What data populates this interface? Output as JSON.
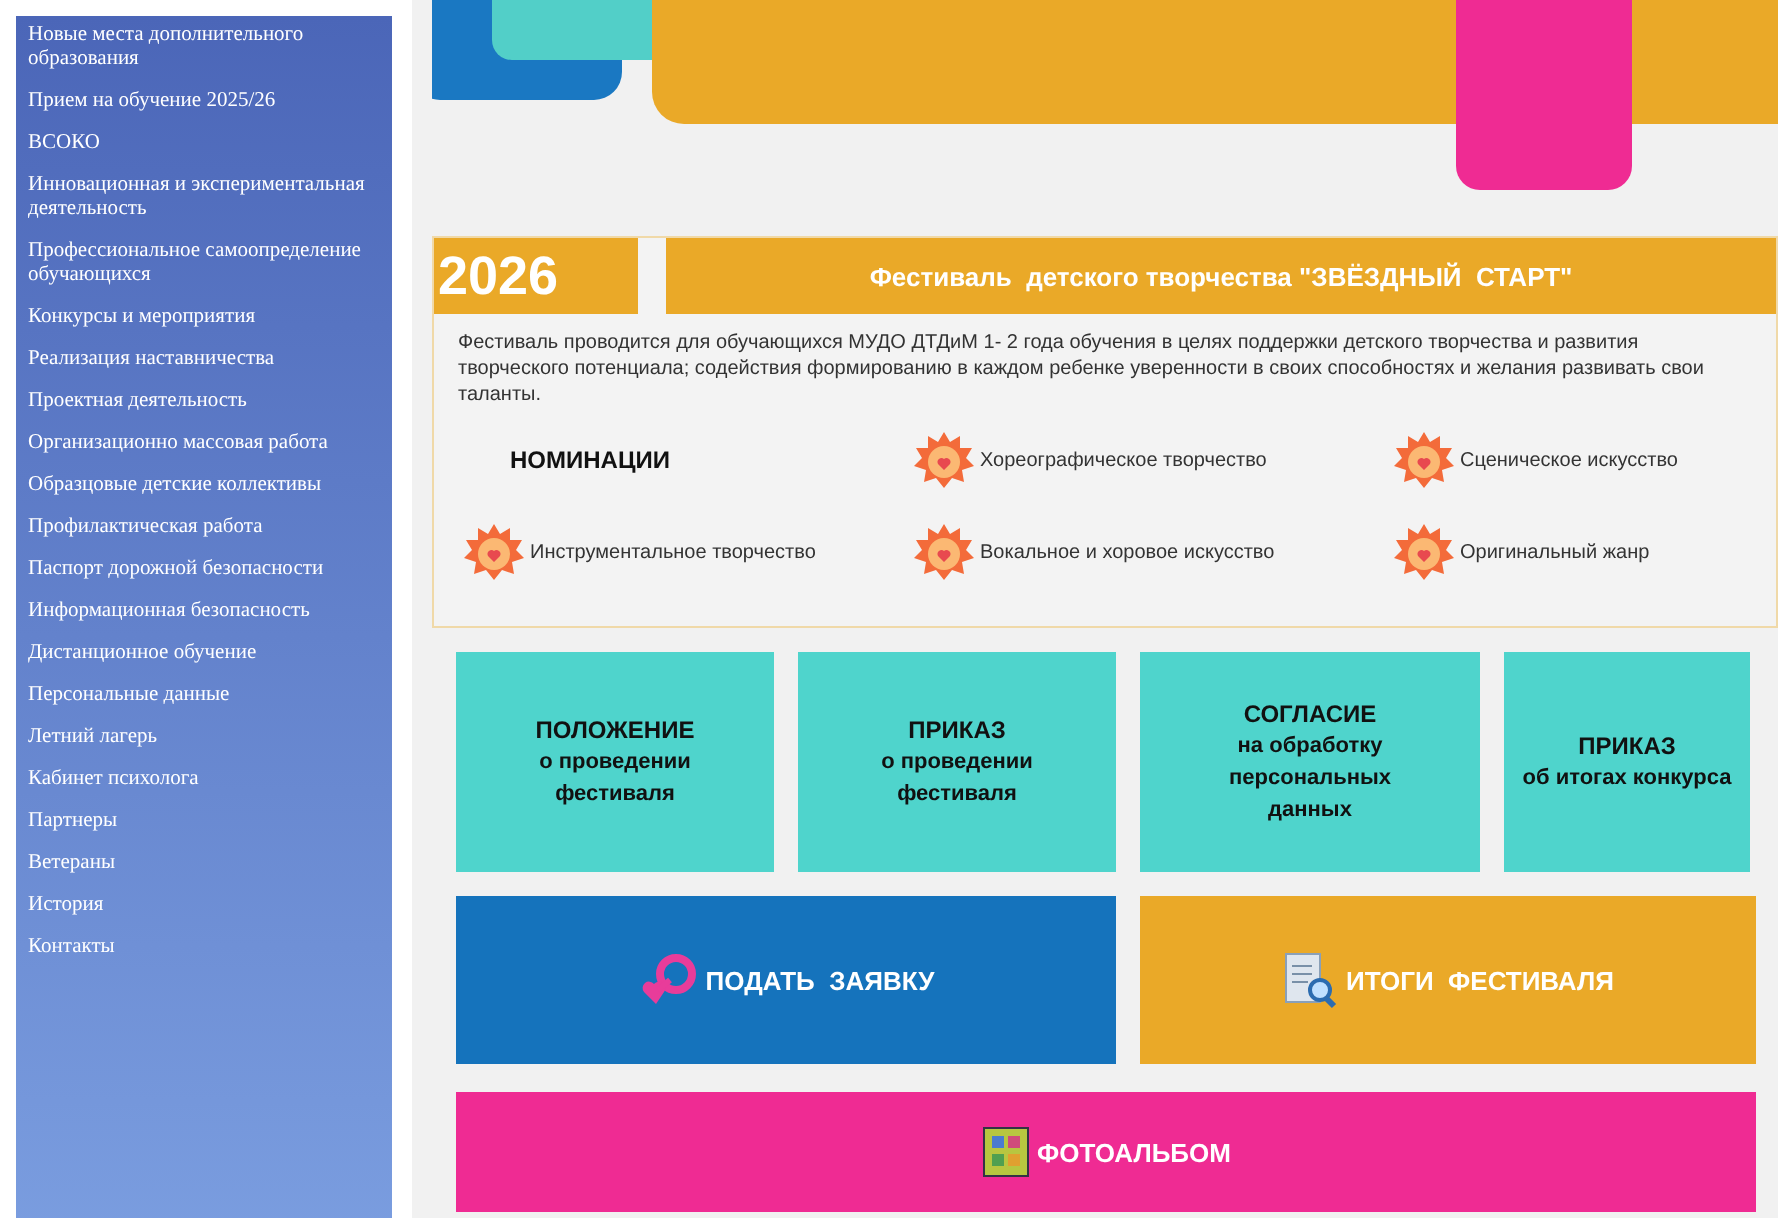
{
  "sidebar": {
    "items": [
      {
        "label": "Новые места дополнительного образования"
      },
      {
        "label": "Прием на обучение 2025/26"
      },
      {
        "label": "ВСОКО"
      },
      {
        "label": "Инновационная и экспериментальная деятельность"
      },
      {
        "label": "Профессиональное самоопределение обучающихся"
      },
      {
        "label": "Конкурсы и мероприятия"
      },
      {
        "label": "Реализация наставничества"
      },
      {
        "label": "Проектная деятельность"
      },
      {
        "label": "Организационно массовая работа"
      },
      {
        "label": "Образцовые детские коллективы"
      },
      {
        "label": "Профилактическая работа"
      },
      {
        "label": "Паспорт дорожной безопасности"
      },
      {
        "label": "Информационная безопасность"
      },
      {
        "label": "Дистанционное обучение"
      },
      {
        "label": "Персональные данные"
      },
      {
        "label": "Летний лагерь"
      },
      {
        "label": "Кабинет психолога"
      },
      {
        "label": "Партнеры"
      },
      {
        "label": "Ветераны"
      },
      {
        "label": "История"
      },
      {
        "label": "Контакты"
      }
    ]
  },
  "festival": {
    "year": "2026",
    "title": "Фестиваль  детского творчества \"ЗВЁЗДНЫЙ  СТАРТ\"",
    "description": "Фестиваль проводится для обучающихся МУДО ДТДиМ 1- 2 года обучения в целях поддержки детского творчества и развития творческого потенциала; содействия формированию в каждом ребенке уверенности  в своих способностях и желания  развивать свои таланты.",
    "nominations_heading": "НОМИНАЦИИ",
    "nominations": [
      "Хореографическое творчество",
      "Сценическое искусство",
      "Инструментальное творчество",
      "Вокальное и хоровое искусство",
      "Оригинальный жанр"
    ]
  },
  "documents": [
    {
      "title": "ПОЛОЖЕНИЕ",
      "subtitle": "о  проведении фестиваля"
    },
    {
      "title": "ПРИКАЗ",
      "subtitle": "о  проведении фестиваля"
    },
    {
      "title": "СОГЛАСИЕ",
      "subtitle": "на обработку персональных данных"
    },
    {
      "title": "ПРИКАЗ",
      "subtitle": "об   итогах конкурса"
    }
  ],
  "actions": [
    {
      "label": "ПОДАТЬ  ЗАЯВКУ",
      "kind": "apply"
    },
    {
      "label": "ИТОГИ  ФЕСТИВАЛЯ",
      "kind": "results"
    },
    {
      "label": "ФОТОАЛЬБОМ",
      "kind": "album"
    }
  ]
}
